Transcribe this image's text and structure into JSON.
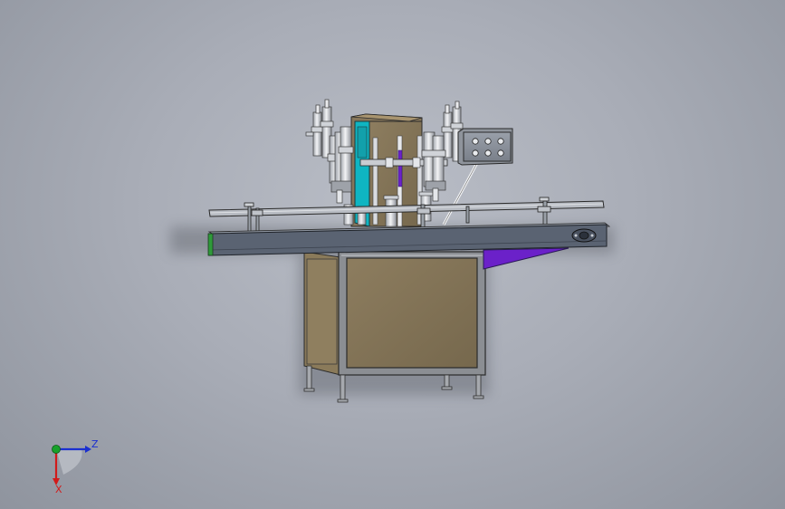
{
  "viewport": {
    "background_top": "#b9bdc6",
    "background_bottom": "#8f949e"
  },
  "model": {
    "body_color": "#86775a",
    "frame_color": "#7f8287",
    "conveyor_color": "#5a6372",
    "cylinder_color": "#e4e6ea",
    "accent_cyan": "#0fb5c2",
    "accent_purple": "#6b21c9",
    "accent_green": "#2f9a3a"
  },
  "triad": {
    "z_label": "Z",
    "x_label": "X",
    "z_color": "#1a2fd0",
    "x_color": "#d21a1a",
    "y_color": "#17a12a",
    "icon": "coordinate-triad-icon"
  }
}
